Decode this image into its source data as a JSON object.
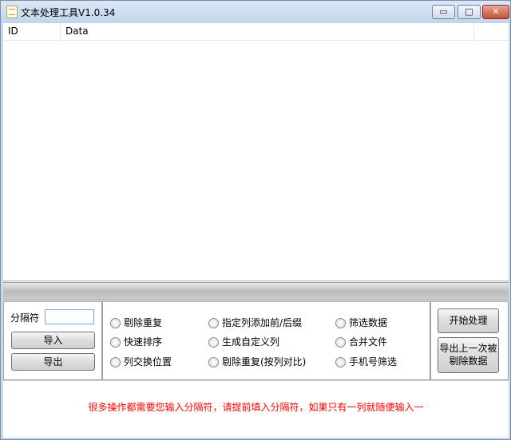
{
  "window": {
    "title": "文本处理工具V1.0.34",
    "min_glyph": "▭",
    "max_glyph": "□",
    "close_glyph": "✕"
  },
  "grid": {
    "columns": [
      "ID",
      "Data",
      ""
    ]
  },
  "left_panel": {
    "separator_label": "分隔符",
    "separator_value": "",
    "import_label": "导入",
    "export_label": "导出"
  },
  "options": [
    "剔除重复",
    "指定列添加前/后缀",
    "筛选数据",
    "快速排序",
    "生成自定义列",
    "合并文件",
    "列交换位置",
    "剔除重复(按列对比)",
    "手机号筛选"
  ],
  "right_panel": {
    "start_label": "开始处理",
    "export_removed_line1": "导出上一次被",
    "export_removed_line2": "剔除数据"
  },
  "notice": "很多操作都需要您输入分隔符，请提前填入分隔符，如果只有一列就随便输入一",
  "colors": {
    "notice": "#ff0000",
    "titlebar": "#c2d5ed",
    "close_button": "#c75039"
  }
}
